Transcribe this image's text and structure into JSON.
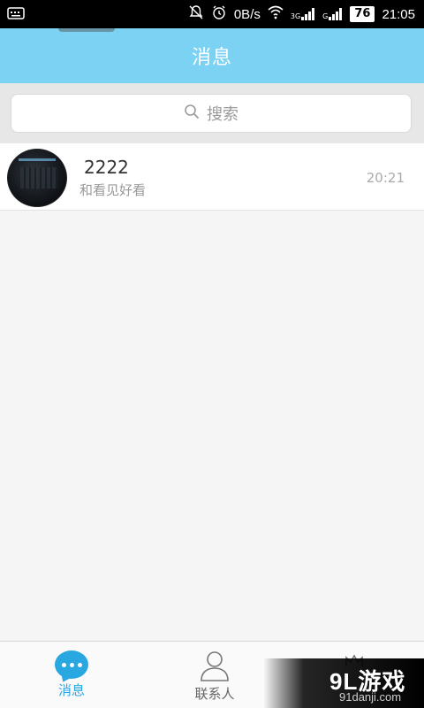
{
  "status_bar": {
    "net_speed": "0B/s",
    "network_label_1": "3G",
    "network_label_2": "G",
    "battery": "76",
    "time": "21:05"
  },
  "header": {
    "title": "消息"
  },
  "search": {
    "placeholder": "搜索"
  },
  "conversations": [
    {
      "name": "2222",
      "preview": "和看见好看",
      "time": "20:21"
    }
  ],
  "tabs": [
    {
      "label": "消息",
      "icon": "message-bubble-icon",
      "active": true
    },
    {
      "label": "联系人",
      "icon": "person-icon",
      "active": false
    }
  ],
  "watermark": {
    "brand": "9L游戏",
    "url": "91danji.com"
  },
  "colors": {
    "header_bg": "#7cd2f2",
    "accent": "#29a7e1"
  }
}
